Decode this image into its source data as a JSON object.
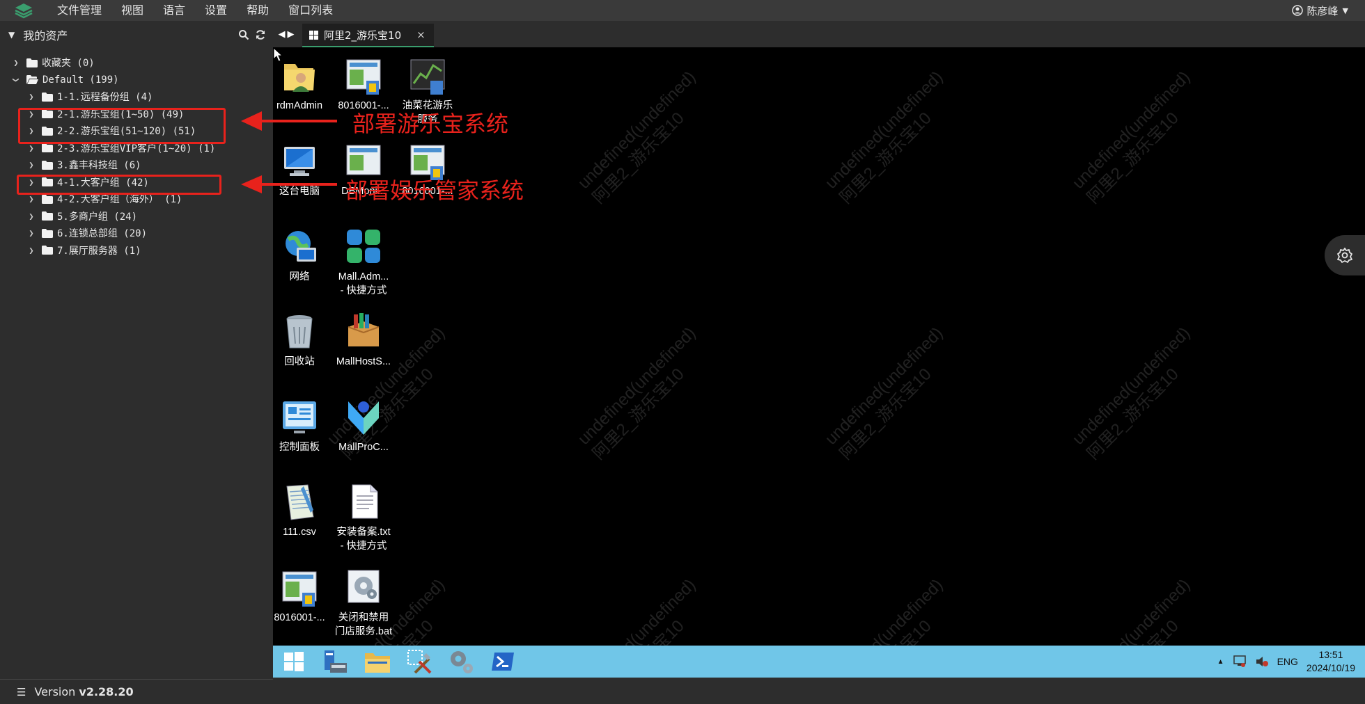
{
  "menubar": {
    "items": [
      "文件管理",
      "视图",
      "语言",
      "设置",
      "帮助",
      "窗口列表"
    ],
    "user": "陈彦峰"
  },
  "sidebar": {
    "title": "我的资产",
    "tree": [
      {
        "label": "收藏夹 (0)",
        "level": 0,
        "expanded": false
      },
      {
        "label": "Default (199)",
        "level": 0,
        "expanded": true
      },
      {
        "label": "1-1.远程备份组 (4)",
        "level": 1,
        "expanded": false
      },
      {
        "label": "2-1.游乐宝组(1~50) (49)",
        "level": 1,
        "expanded": false
      },
      {
        "label": "2-2.游乐宝组(51~120) (51)",
        "level": 1,
        "expanded": false
      },
      {
        "label": "2-3.游乐宝组VIP客户(1~20) (1)",
        "level": 1,
        "expanded": false
      },
      {
        "label": "3.鑫丰科技组 (6)",
        "level": 1,
        "expanded": false
      },
      {
        "label": "4-1.大客户组 (42)",
        "level": 1,
        "expanded": false
      },
      {
        "label": "4-2.大客户组（海外） (1)",
        "level": 1,
        "expanded": false
      },
      {
        "label": "5.多商户组 (24)",
        "level": 1,
        "expanded": false
      },
      {
        "label": "6.连锁总部组 (20)",
        "level": 1,
        "expanded": false
      },
      {
        "label": "7.展厅服务器 (1)",
        "level": 1,
        "expanded": false
      }
    ],
    "version_prefix": "Version",
    "version": "v2.28.20"
  },
  "tab": {
    "title": "阿里2_游乐宝10",
    "close": "×"
  },
  "desktop": {
    "icons": [
      {
        "label": "rdmAdmin",
        "icon": "user-folder-icon"
      },
      {
        "label": "8016001-...",
        "icon": "shortcut-app-icon"
      },
      {
        "label": "油菜花游乐\n服务",
        "icon": "chart-app-icon"
      },
      {
        "label": "这台电脑",
        "icon": "computer-icon"
      },
      {
        "label": "DBMoni...",
        "icon": "shortcut-app-icon"
      },
      {
        "label": "8016001-...",
        "icon": "shortcut-app-icon"
      },
      {
        "label": "网络",
        "icon": "network-icon"
      },
      {
        "label": "Mall.Adm...\n- 快捷方式",
        "icon": "mall-admin-icon"
      },
      {
        "label": "回收站",
        "icon": "recycle-bin-icon"
      },
      {
        "label": "MallHostS...",
        "icon": "package-icon"
      },
      {
        "label": "控制面板",
        "icon": "control-panel-icon"
      },
      {
        "label": "MallProC...",
        "icon": "mall-pro-icon"
      },
      {
        "label": "111.csv",
        "icon": "csv-file-icon"
      },
      {
        "label": "安装备案.txt\n- 快捷方式",
        "icon": "txt-file-icon"
      },
      {
        "label": "8016001-...",
        "icon": "shortcut-app-icon"
      },
      {
        "label": "关闭和禁用\n门店服务.bat",
        "icon": "bat-file-icon"
      }
    ],
    "watermark_line1": "undefined(undefined)",
    "watermark_line2": "阿里2_游乐宝10"
  },
  "annotations": {
    "text1": "部署游乐宝系统",
    "text2": "部署娱乐管家系统",
    "color": "#e8221c"
  },
  "taskbar": {
    "lang": "ENG",
    "time": "13:51",
    "date": "2024/10/19",
    "tray_up": "▲"
  },
  "colors": {
    "menubar": "#3a3a3a",
    "sidebar": "#2d2d2d",
    "taskbar": "#70c6e8",
    "tab_accent": "#3a9e6e"
  }
}
